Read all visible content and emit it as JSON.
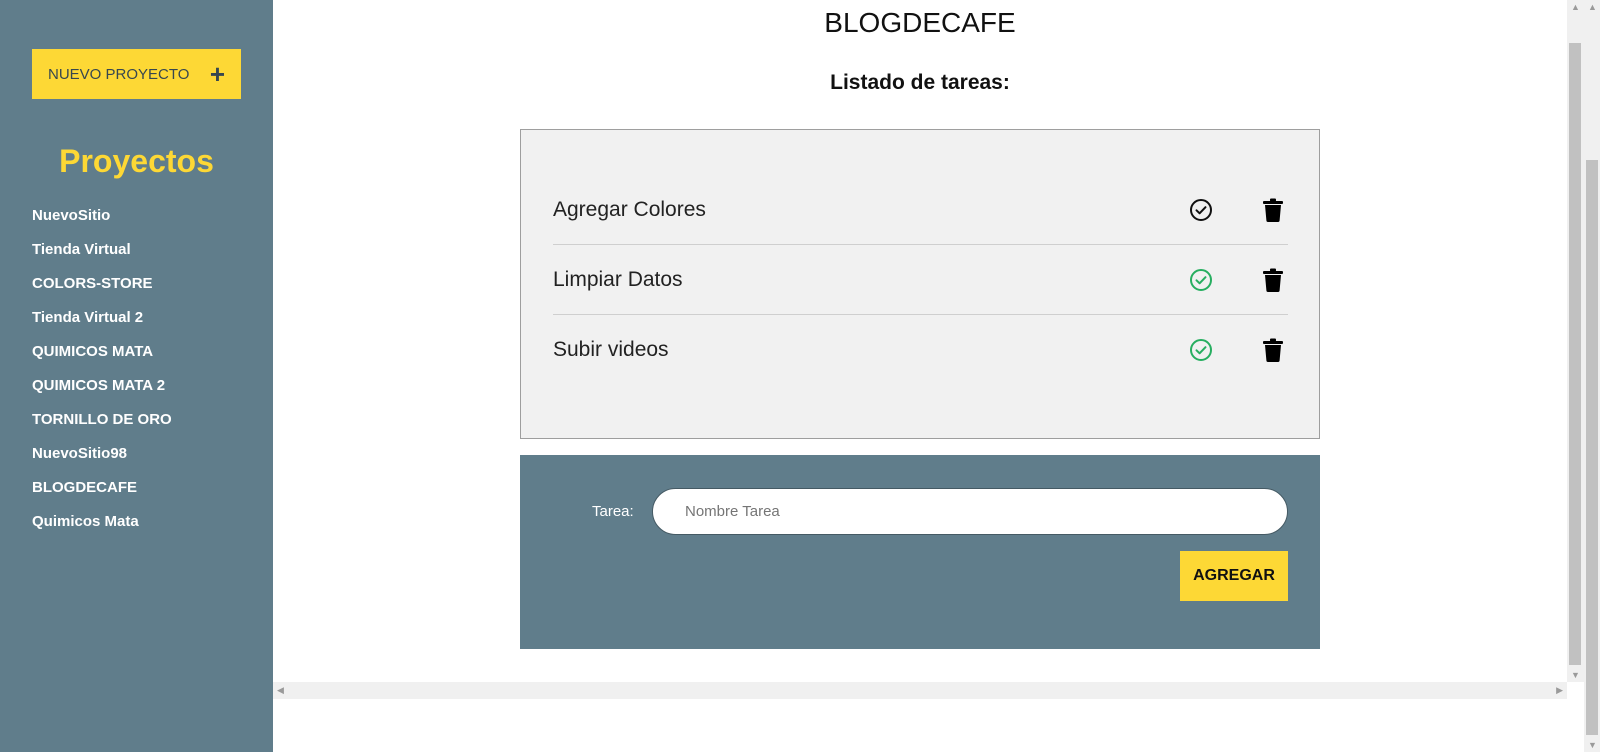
{
  "sidebar": {
    "new_project_label": "NUEVO PROYECTO",
    "new_project_icon": "plus-icon",
    "title": "Proyectos",
    "projects": [
      "NuevoSitio",
      "Tienda Virtual",
      "COLORS-STORE",
      "Tienda Virtual 2",
      "QUIMICOS MATA",
      "QUIMICOS MATA 2",
      "TORNILLO DE ORO",
      "NuevoSitio98",
      "BLOGDECAFE",
      "Quimicos Mata"
    ]
  },
  "main": {
    "project_name": "BLOGDECAFE",
    "list_heading": "Listado de tareas:",
    "tasks": [
      {
        "name": "Agregar Colores",
        "completed": false,
        "check_icon": "check-circle-icon",
        "delete_icon": "trash-icon"
      },
      {
        "name": "Limpiar Datos",
        "completed": true,
        "check_icon": "check-circle-icon",
        "delete_icon": "trash-icon"
      },
      {
        "name": "Subir videos",
        "completed": true,
        "check_icon": "check-circle-icon",
        "delete_icon": "trash-icon"
      }
    ]
  },
  "form": {
    "label": "Tarea:",
    "placeholder": "Nombre Tarea",
    "value": "",
    "submit_label": "AGREGAR"
  },
  "colors": {
    "sidebar_bg": "#607d8b",
    "accent": "#fdd835",
    "completed": "#27ae60",
    "pending": "#111111"
  }
}
